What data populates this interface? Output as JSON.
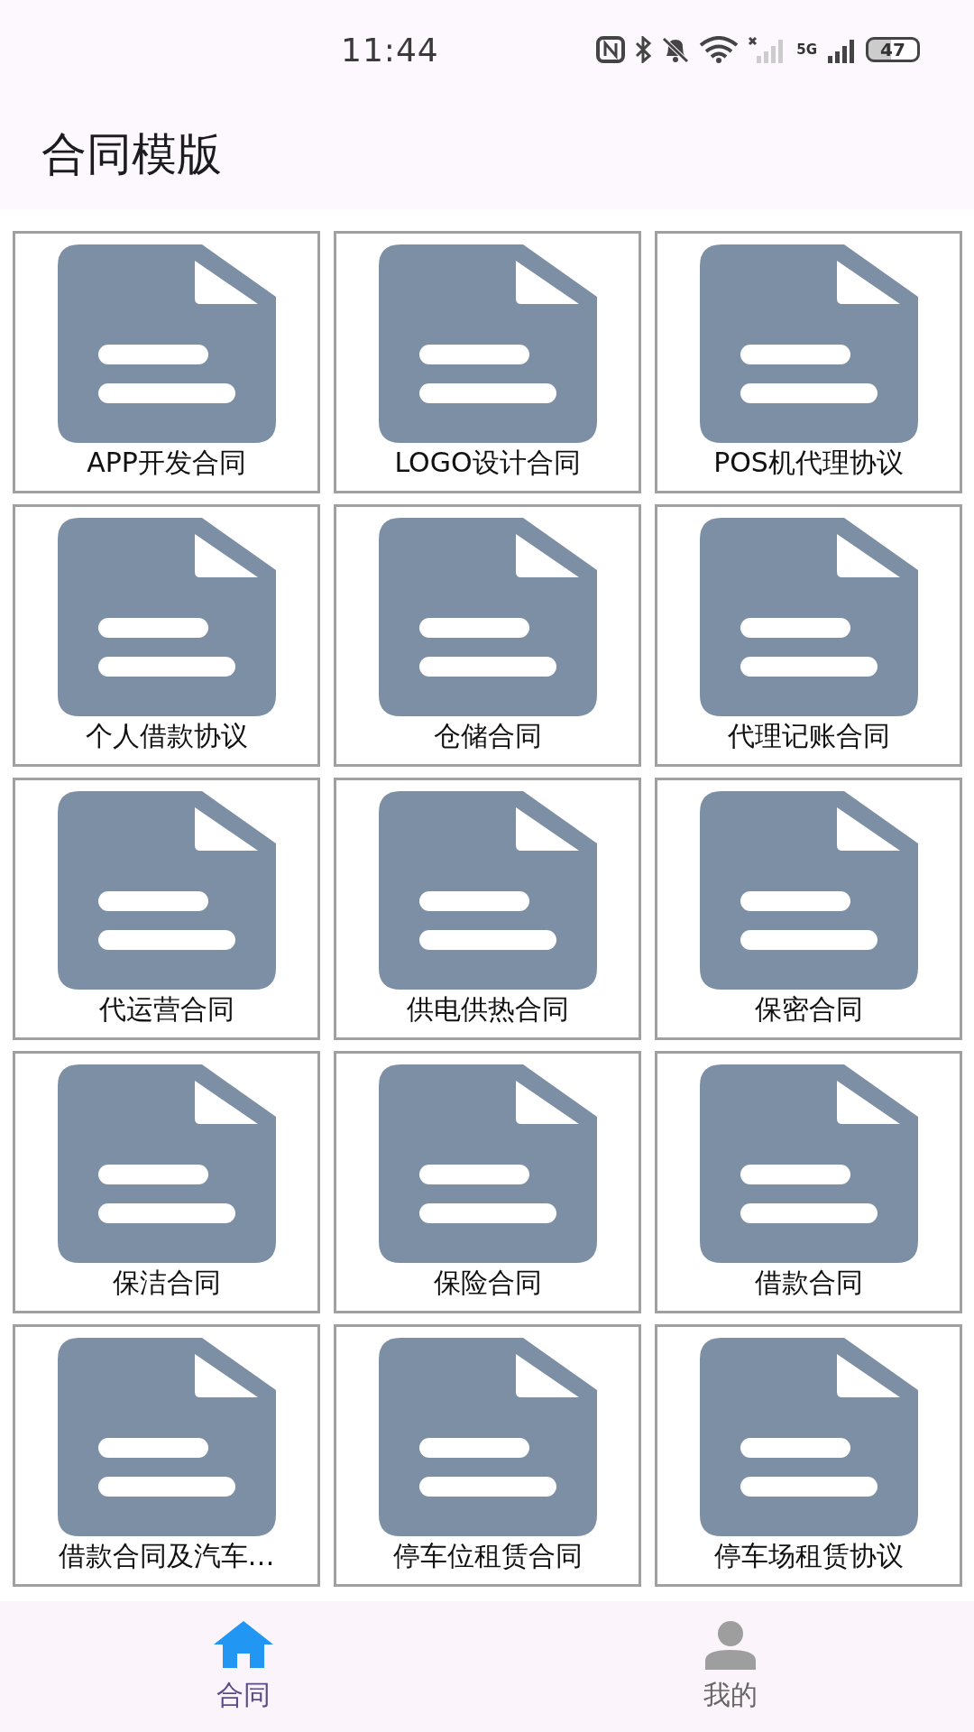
{
  "status_bar": {
    "time": "11:44",
    "network": "5G",
    "battery": "47"
  },
  "title": "合同模版",
  "contracts": [
    {
      "label": "APP开发合同"
    },
    {
      "label": "LOGO设计合同"
    },
    {
      "label": "POS机代理协议"
    },
    {
      "label": "个人借款协议"
    },
    {
      "label": "仓储合同"
    },
    {
      "label": "代理记账合同"
    },
    {
      "label": "代运营合同"
    },
    {
      "label": "供电供热合同"
    },
    {
      "label": "保密合同"
    },
    {
      "label": "保洁合同"
    },
    {
      "label": "保险合同"
    },
    {
      "label": "借款合同"
    },
    {
      "label": "借款合同及汽车…"
    },
    {
      "label": "停车位租赁合同"
    },
    {
      "label": "停车场租赁协议"
    }
  ],
  "nav": [
    {
      "kind": "home",
      "label": "合同",
      "selected": true
    },
    {
      "kind": "profile",
      "label": "我的",
      "selected": false
    }
  ]
}
